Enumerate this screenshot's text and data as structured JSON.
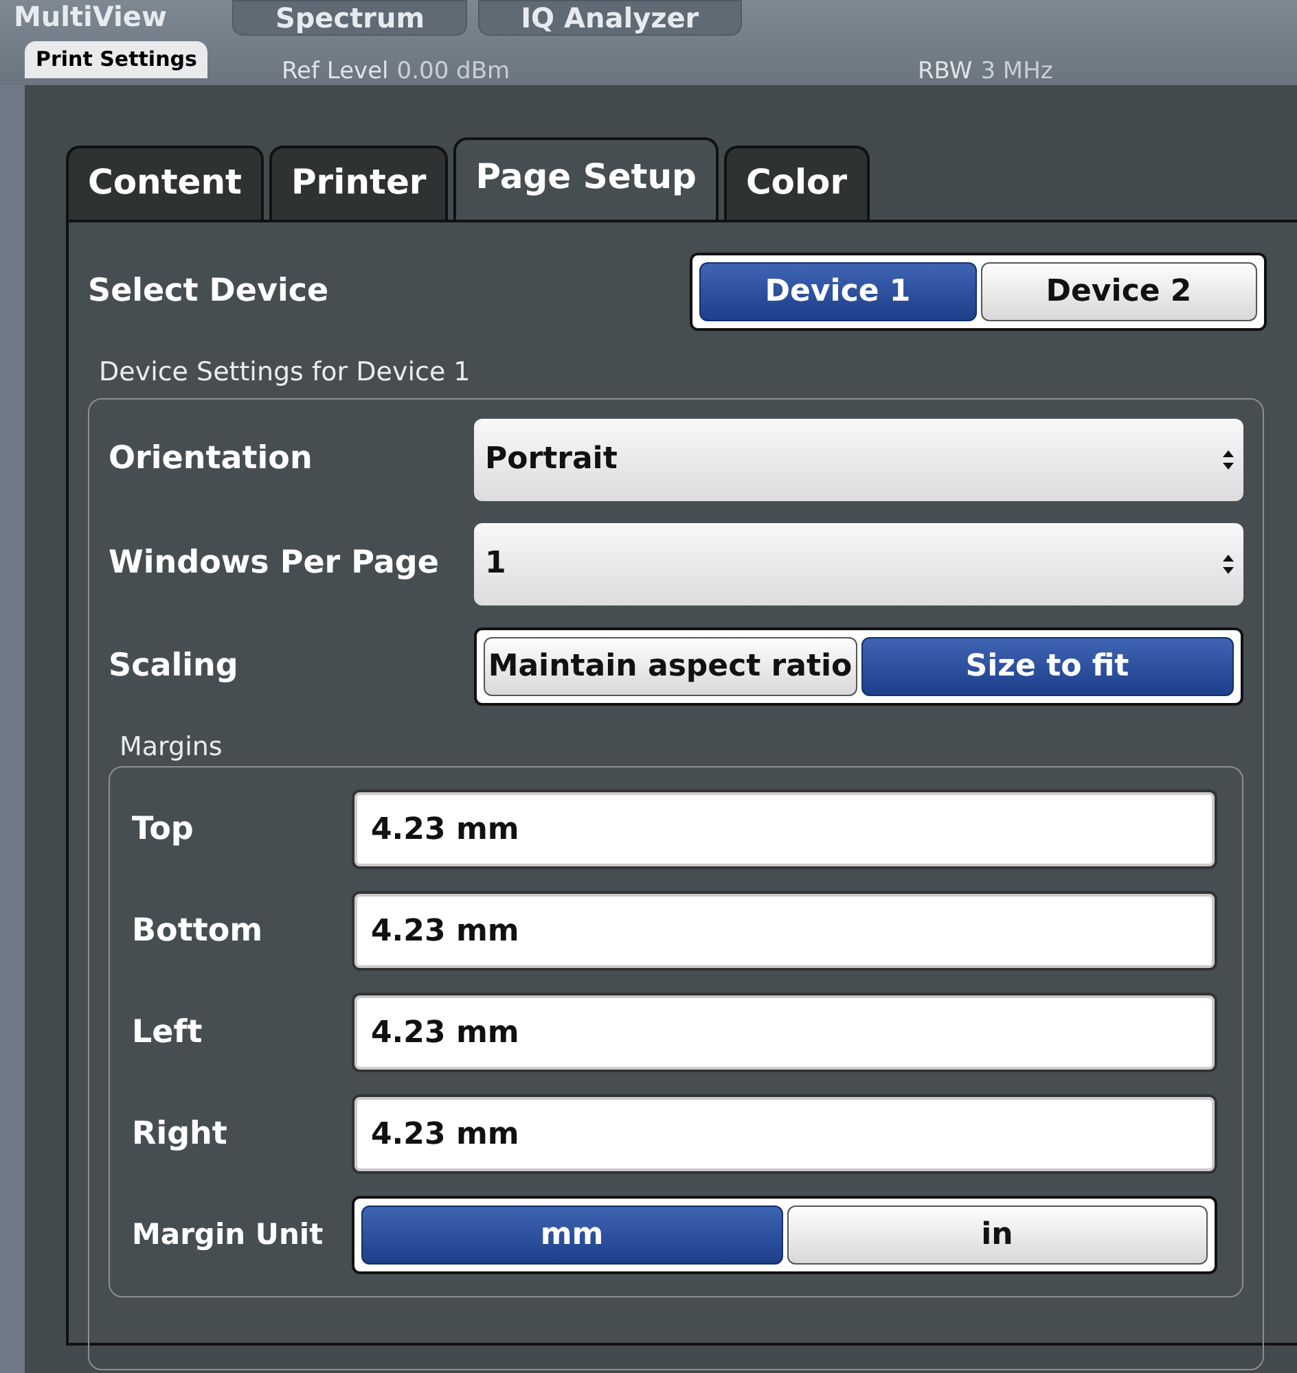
{
  "background": {
    "view_label": "MultiView",
    "tabs": [
      {
        "label": "Spectrum"
      },
      {
        "label": "IQ Analyzer"
      }
    ],
    "dialog_title": "Print Settings",
    "ref_level": {
      "label": "Ref Level",
      "value": "0.00 dBm"
    },
    "rbw": {
      "label": "RBW",
      "value": "3 MHz"
    }
  },
  "tabs": [
    {
      "label": "Content",
      "selected": false
    },
    {
      "label": "Printer",
      "selected": false
    },
    {
      "label": "Page Setup",
      "selected": true
    },
    {
      "label": "Color",
      "selected": false
    }
  ],
  "select_device": {
    "label": "Select Device",
    "options": [
      {
        "label": "Device 1",
        "selected": true
      },
      {
        "label": "Device 2",
        "selected": false
      }
    ]
  },
  "device_settings": {
    "title": "Device Settings for Device 1",
    "orientation": {
      "label": "Orientation",
      "value": "Portrait"
    },
    "windows_per_page": {
      "label": "Windows Per Page",
      "value": "1"
    },
    "scaling": {
      "label": "Scaling",
      "options": [
        {
          "label": "Maintain aspect ratio",
          "selected": false
        },
        {
          "label": "Size to fit",
          "selected": true
        }
      ]
    },
    "margins": {
      "title": "Margins",
      "fields": [
        {
          "label": "Top",
          "value": "4.23 mm"
        },
        {
          "label": "Bottom",
          "value": "4.23 mm"
        },
        {
          "label": "Left",
          "value": "4.23 mm"
        },
        {
          "label": "Right",
          "value": "4.23 mm"
        }
      ],
      "unit": {
        "label": "Margin Unit",
        "options": [
          {
            "label": "mm",
            "selected": true
          },
          {
            "label": "in",
            "selected": false
          }
        ]
      }
    }
  }
}
